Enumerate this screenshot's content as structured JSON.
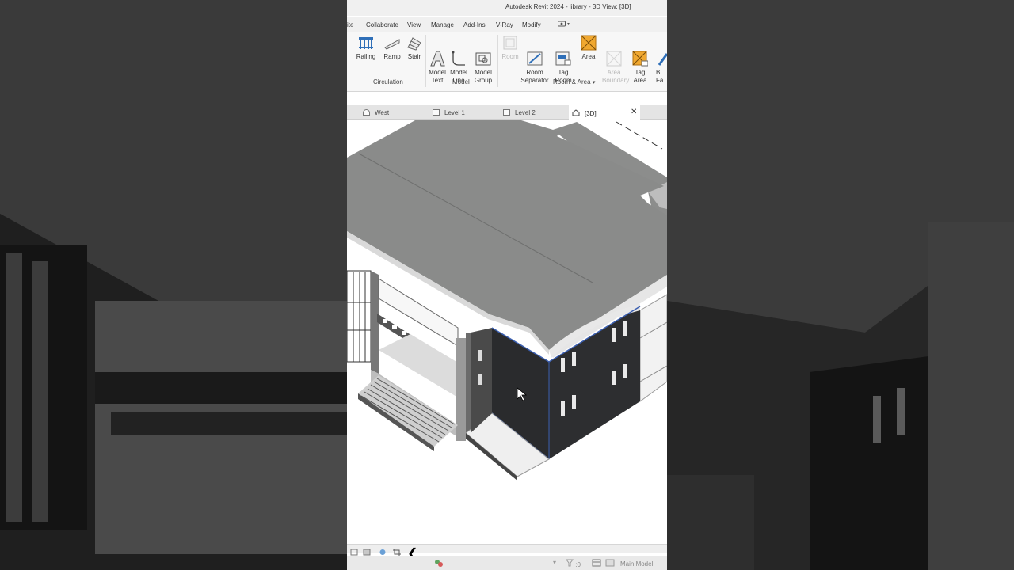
{
  "window": {
    "title": "Autodesk Revit 2024 - library - 3D View: [3D]"
  },
  "menu": {
    "items": [
      "ite",
      "Collaborate",
      "View",
      "Manage",
      "Add-Ins",
      "V-Ray",
      "Modify"
    ]
  },
  "ribbon": {
    "groups": [
      {
        "label": "Circulation",
        "tools": [
          {
            "label": "Railing"
          },
          {
            "label": "Ramp"
          },
          {
            "label": "Stair"
          }
        ]
      },
      {
        "label": "Model",
        "tools": [
          {
            "label": "Model\nText"
          },
          {
            "label": "Model\nLine"
          },
          {
            "label": "Model\nGroup"
          }
        ]
      },
      {
        "label": "Room & Area",
        "tools": [
          {
            "label": "Room"
          },
          {
            "label": "Room\nSeparator"
          },
          {
            "label": "Tag\nRoom"
          },
          {
            "label": "Area"
          },
          {
            "label": "Area\nBoundary"
          },
          {
            "label": "Tag\nArea"
          },
          {
            "label": "B\nFa"
          }
        ]
      }
    ]
  },
  "view_tabs": [
    {
      "label": "West"
    },
    {
      "label": "Level 1"
    },
    {
      "label": "Level 2"
    },
    {
      "label": "[3D]"
    }
  ],
  "status": {
    "model": "Main Model",
    "count": ":0"
  },
  "colors": {
    "roof": "#8a8b8a",
    "wall_dark": "#2e2f31",
    "wall_light": "#f2f2f2",
    "selection": "#3b5fb0",
    "folder_orange": "#f0a830"
  }
}
